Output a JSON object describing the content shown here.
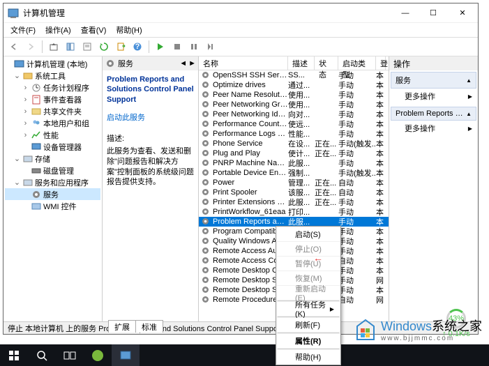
{
  "window": {
    "title": "计算机管理"
  },
  "menubar": [
    "文件(F)",
    "操作(A)",
    "查看(V)",
    "帮助(H)"
  ],
  "tree": {
    "root": "计算机管理 (本地)",
    "system_tools": "系统工具",
    "task_scheduler": "任务计划程序",
    "event_viewer": "事件查看器",
    "shared_folders": "共享文件夹",
    "local_users": "本地用户和组",
    "performance": "性能",
    "device_mgr": "设备管理器",
    "storage": "存储",
    "disk_mgmt": "磁盘管理",
    "services_apps": "服务和应用程序",
    "services": "服务",
    "wmi": "WMI 控件"
  },
  "deskpane": {
    "header": "服务",
    "title": "Problem Reports and Solutions Control Panel Support",
    "start_link": "启动此服务",
    "desc_label": "描述:",
    "desc": "此服务为查看、发送和删除\"问题报告和解决方案\"控制面板的系统级问题报告提供支持。"
  },
  "list": {
    "columns": {
      "name": "名称",
      "desc": "描述",
      "status": "状态",
      "startup": "启动类型",
      "logon": "登"
    },
    "rows": [
      {
        "n": "OpenSSH SSH Server",
        "d": "SS...",
        "s": "",
        "t": "手动",
        "l": "本"
      },
      {
        "n": "Optimize drives",
        "d": "通过...",
        "s": "",
        "t": "手动",
        "l": "本"
      },
      {
        "n": "Peer Name Resolution Pr...",
        "d": "使用...",
        "s": "",
        "t": "手动",
        "l": "本"
      },
      {
        "n": "Peer Networking Groupi...",
        "d": "使用...",
        "s": "",
        "t": "手动",
        "l": "本"
      },
      {
        "n": "Peer Networking Identity...",
        "d": "向对...",
        "s": "",
        "t": "手动",
        "l": "本"
      },
      {
        "n": "Performance Counter DL...",
        "d": "使远...",
        "s": "",
        "t": "手动",
        "l": "本"
      },
      {
        "n": "Performance Logs & Aler...",
        "d": "性能...",
        "s": "",
        "t": "手动",
        "l": "本"
      },
      {
        "n": "Phone Service",
        "d": "在设...",
        "s": "正在...",
        "t": "手动(触发...",
        "l": "本"
      },
      {
        "n": "Plug and Play",
        "d": "使计...",
        "s": "正在...",
        "t": "手动",
        "l": "本"
      },
      {
        "n": "PNRP Machine Name Pu...",
        "d": "此服...",
        "s": "",
        "t": "手动",
        "l": "本"
      },
      {
        "n": "Portable Device Enumera...",
        "d": "强制...",
        "s": "",
        "t": "手动(触发...",
        "l": "本"
      },
      {
        "n": "Power",
        "d": "管理...",
        "s": "正在...",
        "t": "自动",
        "l": "本"
      },
      {
        "n": "Print Spooler",
        "d": "该服...",
        "s": "正在...",
        "t": "自动",
        "l": "本"
      },
      {
        "n": "Printer Extensions and N...",
        "d": "此服...",
        "s": "正在...",
        "t": "手动",
        "l": "本"
      },
      {
        "n": "PrintWorkflow_61eaa",
        "d": "打印...",
        "s": "",
        "t": "手动",
        "l": "本"
      },
      {
        "n": "Problem Reports and S...",
        "d": "此服...",
        "s": "",
        "t": "手动",
        "l": "本",
        "sel": true
      },
      {
        "n": "Program Compatibil",
        "d": "",
        "s": "",
        "t": "手动",
        "l": "本"
      },
      {
        "n": "Quality Windows Ad",
        "d": "",
        "s": "",
        "t": "手动",
        "l": "本"
      },
      {
        "n": "Remote Access Aut",
        "d": "",
        "s": "",
        "t": "手动",
        "l": "本"
      },
      {
        "n": "Remote Access Co",
        "d": "",
        "s": "",
        "t": "自动",
        "l": "本"
      },
      {
        "n": "Remote Desktop C",
        "d": "",
        "s": "",
        "t": "手动",
        "l": "本"
      },
      {
        "n": "Remote Desktop S",
        "d": "",
        "s": "",
        "t": "手动",
        "l": "网"
      },
      {
        "n": "Remote Desktop S",
        "d": "",
        "s": "",
        "t": "手动",
        "l": "本"
      },
      {
        "n": "Remote Procedure",
        "d": "",
        "s": "",
        "t": "自动",
        "l": "网"
      }
    ]
  },
  "tabs": {
    "extended": "扩展",
    "standard": "标准"
  },
  "actions": {
    "header": "操作",
    "section1": "服务",
    "more1": "更多操作",
    "section2": "Problem Reports and Sol...",
    "more2": "更多操作"
  },
  "ctx": {
    "start": "启动(S)",
    "stop": "停止(O)",
    "pause": "暂停(U)",
    "resume": "恢复(M)",
    "restart": "重新启动(E)",
    "all_tasks": "所有任务(K)",
    "refresh": "刷新(F)",
    "properties": "属性(R)",
    "help": "帮助(H)"
  },
  "statusbar": "停止 本地计算机 上的服务 Problem Reports and Solutions Control Panel Support",
  "netw": {
    "pct": "43%",
    "spd": "↑ 0.1K/s"
  },
  "watermark": {
    "big": "Windows",
    "small": "系统之家",
    "url": "www.bjjmmc.com"
  }
}
